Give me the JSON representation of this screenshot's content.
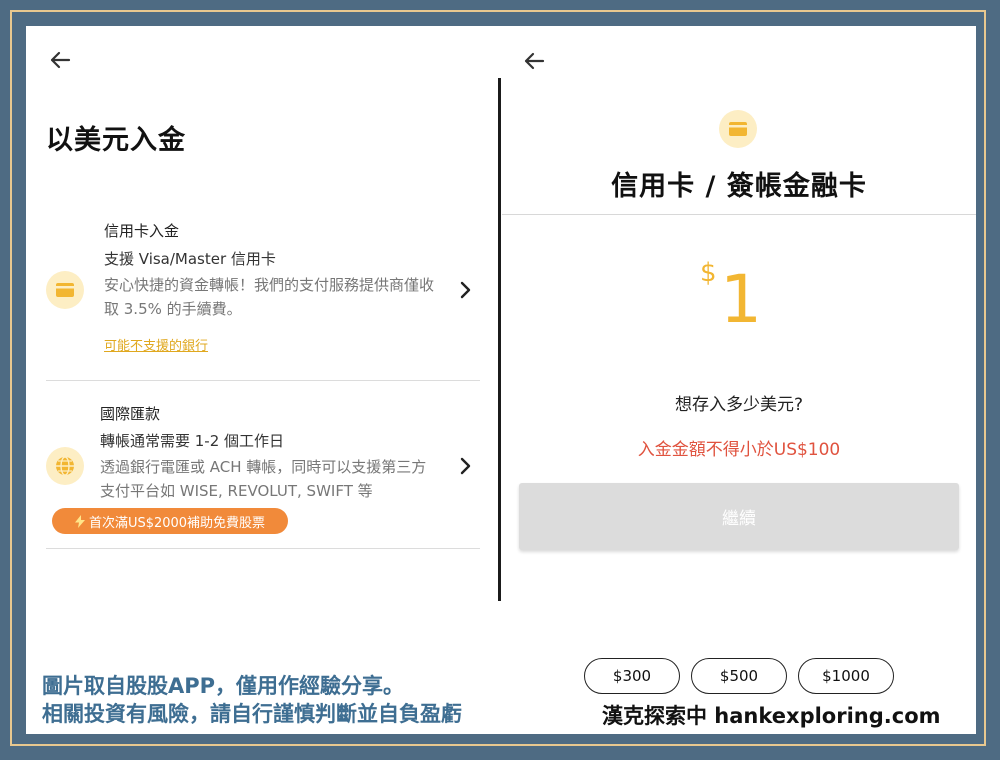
{
  "left_panel": {
    "title": "以美元入金",
    "options": [
      {
        "title": "信用卡入金",
        "subtitle": "支援 Visa/Master 信用卡",
        "description": "安心快捷的資金轉帳！我們的支付服務提供商僅收取 3.5% 的手續費。",
        "link": "可能不支援的銀行",
        "icon": "credit-card-icon"
      },
      {
        "title": "國際匯款",
        "subtitle": "轉帳通常需要 1-2 個工作日",
        "description": "透過銀行電匯或 ACH 轉帳，同時可以支援第三方支付平台如 WISE, REVOLUT, SWIFT 等",
        "promo": "首次滿US$2000補助免費股票",
        "icon": "globe-icon"
      }
    ]
  },
  "right_panel": {
    "title": "信用卡 / 簽帳金融卡",
    "currency_symbol": "$",
    "amount": "1",
    "prompt": "想存入多少美元?",
    "error": "入金金額不得小於US$100",
    "continue_label": "繼續",
    "presets": [
      "$300",
      "$500",
      "$1000"
    ]
  },
  "footer": {
    "line1": "圖片取自股股APP，僅用作經驗分享。",
    "line2": "相關投資有風險，請自行謹慎判斷並自負盈虧",
    "brand": "漢克探索中 hankexploring.com"
  },
  "colors": {
    "background": "#4e6b83",
    "accent_gold": "#f2b632",
    "promo_orange": "#f18a3a",
    "error_red": "#e0533f",
    "footer_blue": "#3e6e92"
  }
}
